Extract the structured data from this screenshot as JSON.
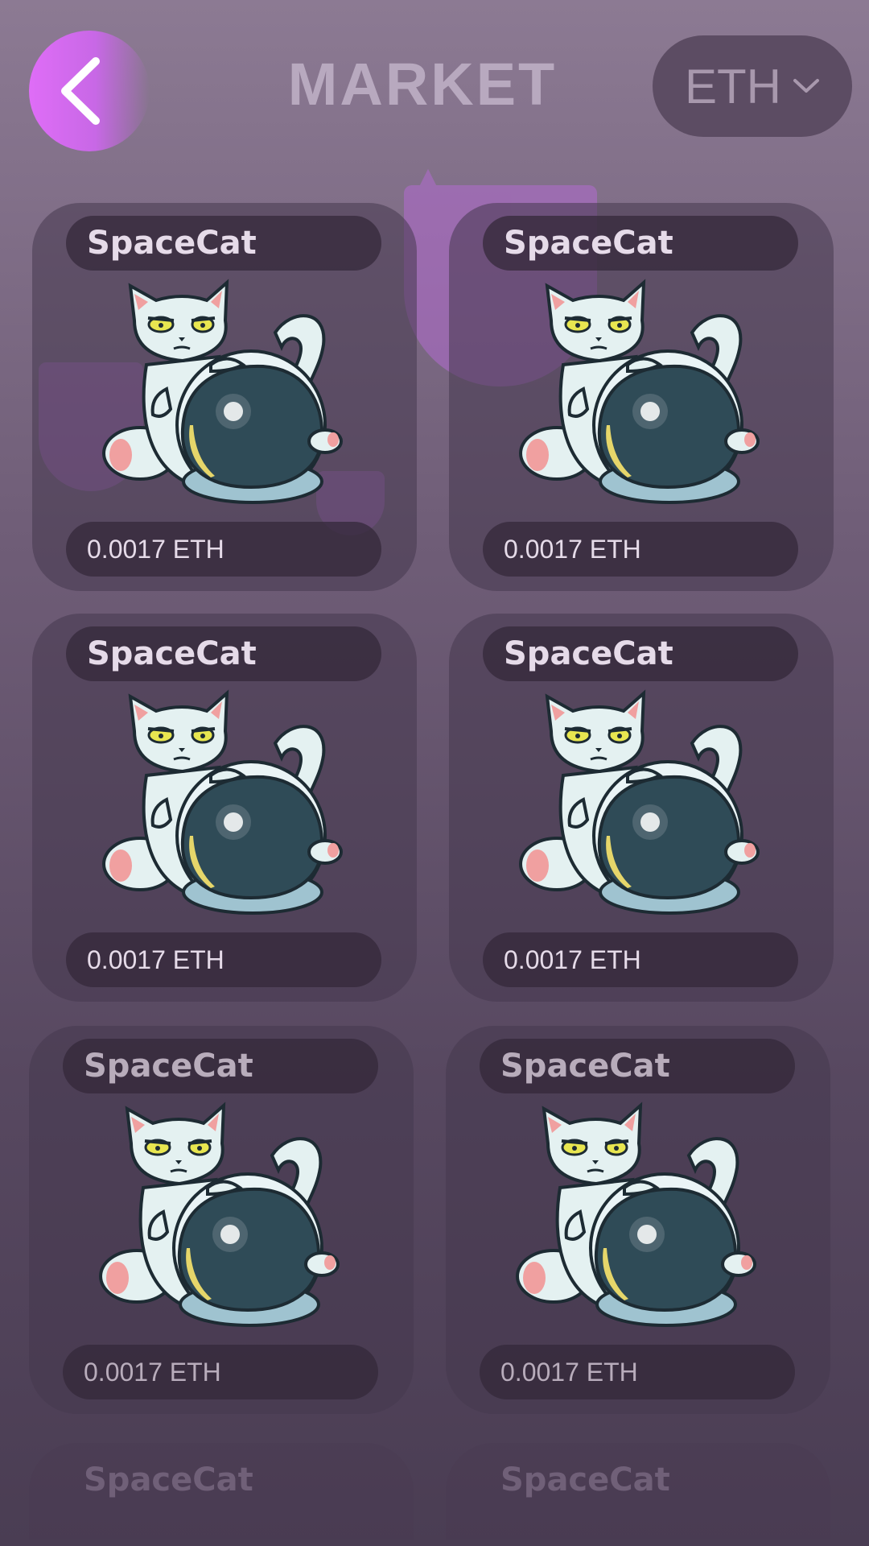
{
  "header": {
    "title": "MARKET",
    "currency_label": "ETH"
  },
  "cards": [
    {
      "name": "SpaceCat",
      "price": "0.0017 ETH"
    },
    {
      "name": "SpaceCat",
      "price": "0.0017 ETH"
    },
    {
      "name": "SpaceCat",
      "price": "0.0017 ETH"
    },
    {
      "name": "SpaceCat",
      "price": "0.0017 ETH"
    },
    {
      "name": "SpaceCat",
      "price": "0.0017 ETH"
    },
    {
      "name": "SpaceCat",
      "price": "0.0017 ETH"
    }
  ],
  "partial_cards": [
    {
      "name": "SpaceCat"
    },
    {
      "name": "SpaceCat"
    }
  ],
  "icons": {
    "back": "chevron-left-icon",
    "currency_dropdown": "chevron-down-icon",
    "card_art": "spacecat-astronaut-illustration"
  },
  "colors": {
    "accent": "#df6df7",
    "background_top": "#8c7a93",
    "background_bottom": "#4a3d53"
  }
}
